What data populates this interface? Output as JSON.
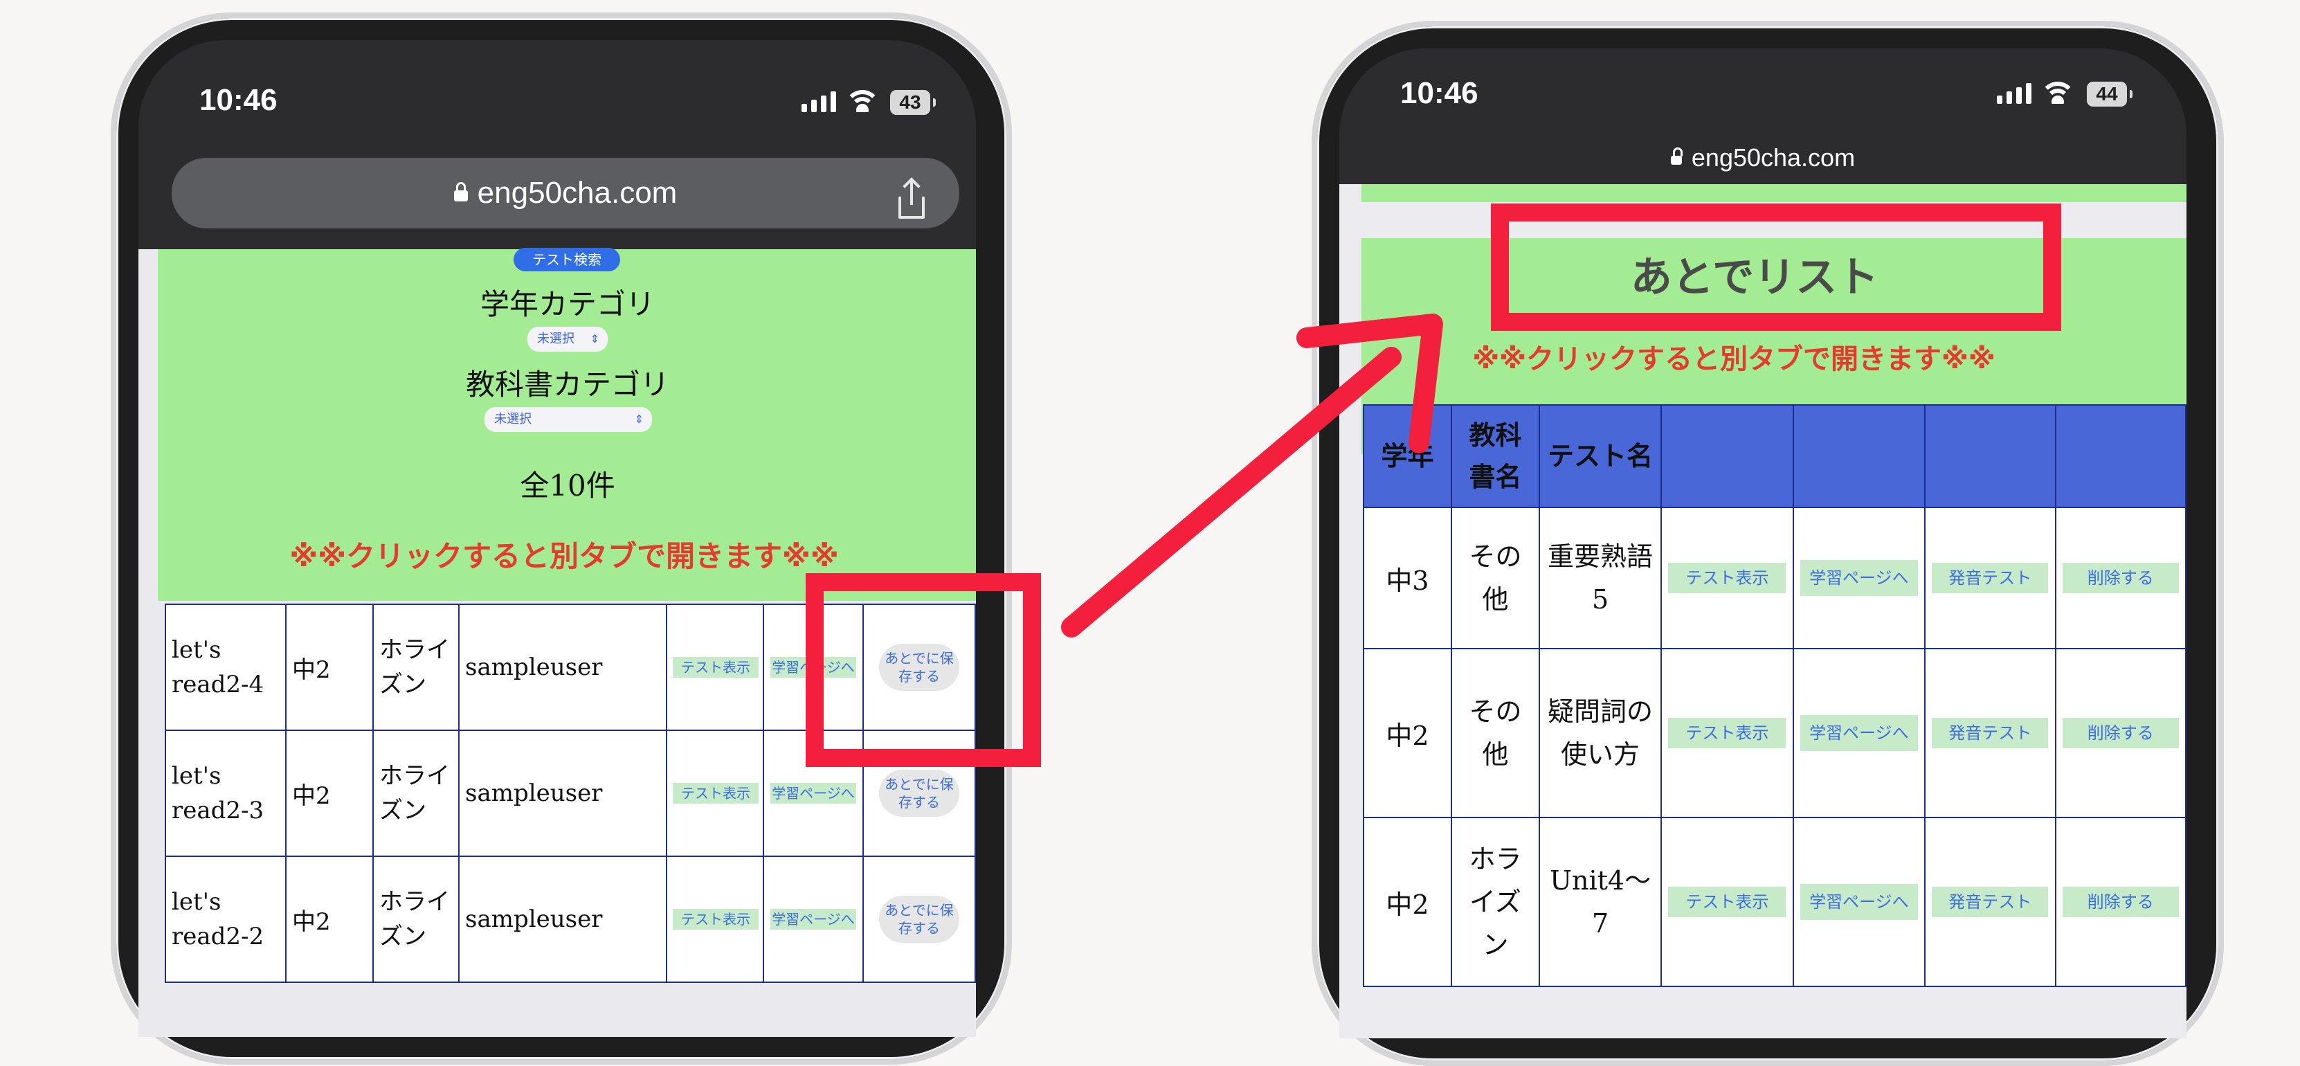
{
  "colors": {
    "accent": "#f2203c",
    "panel_green": "#a4ec93",
    "table_header_blue": "#4a67d8",
    "note_red": "#e33b2e",
    "border_navy": "#1d2d8c"
  },
  "left_phone": {
    "status_time": "10:46",
    "battery": "43",
    "url": "eng50cha.com",
    "badge": "テスト検索",
    "grade_category_label": "学年カテゴリ",
    "grade_select_value": "未選択",
    "textbook_category_label": "教科書カテゴリ",
    "textbook_select_value": "未選択",
    "total_count": "全10件",
    "new_tab_note": "※※クリックすると別タブで開きます※※",
    "rows": [
      {
        "title": "let's read2-4",
        "grade": "中2",
        "textbook": "ホライズン",
        "user": "sampleuser",
        "test_btn": "テスト表示",
        "study_btn": "学習ページへ",
        "save_btn": "あとでに保存する"
      },
      {
        "title": "let's read2-3",
        "grade": "中2",
        "textbook": "ホライズン",
        "user": "sampleuser",
        "test_btn": "テスト表示",
        "study_btn": "学習ページへ",
        "save_btn": "あとでに保存する"
      },
      {
        "title": "let's read2-2",
        "grade": "中2",
        "textbook": "ホライズン",
        "user": "sampleuser",
        "test_btn": "テスト表示",
        "study_btn": "学習ページへ",
        "save_btn": "あとでに保存する"
      }
    ]
  },
  "right_phone": {
    "status_time": "10:46",
    "battery": "44",
    "url": "eng50cha.com",
    "list_title": "あとでリスト",
    "new_tab_note": "※※クリックすると別タブで開きます※※",
    "headers": [
      "学年",
      "教科書名",
      "テスト名",
      "",
      "",
      "",
      ""
    ],
    "rows": [
      {
        "grade": "中3",
        "textbook": "その他",
        "test": "重要熟語5",
        "test_btn": "テスト表示",
        "study_btn": "学習ページへ",
        "pron_btn": "発音テスト",
        "del_btn": "削除する"
      },
      {
        "grade": "中2",
        "textbook": "その他",
        "test": "疑問詞の使い方",
        "test_btn": "テスト表示",
        "study_btn": "学習ページへ",
        "pron_btn": "発音テスト",
        "del_btn": "削除する"
      },
      {
        "grade": "中2",
        "textbook": "ホライズン",
        "test": "Unit4〜7",
        "test_btn": "テスト表示",
        "study_btn": "学習ページへ",
        "pron_btn": "発音テスト",
        "del_btn": "削除する"
      }
    ]
  }
}
